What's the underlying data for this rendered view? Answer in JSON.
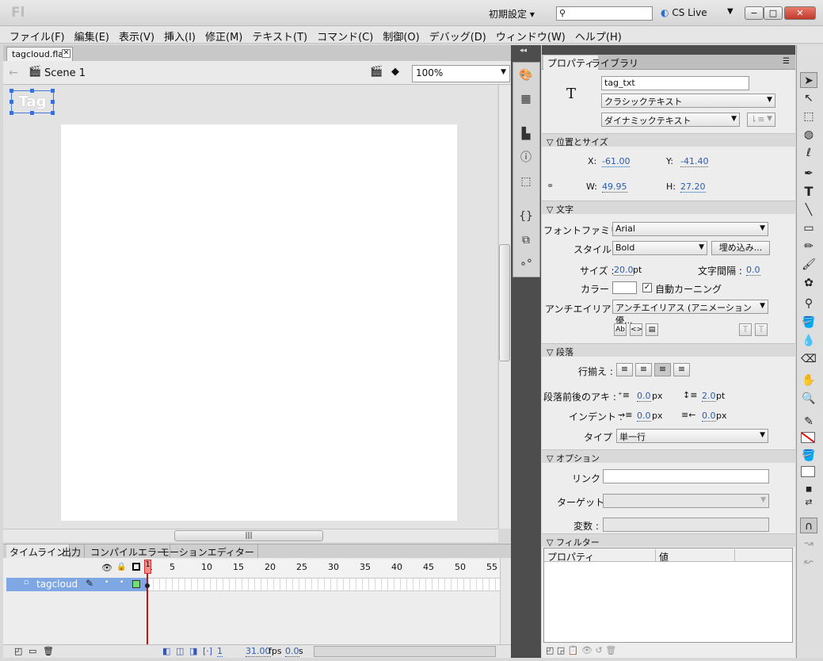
{
  "app": {
    "logo": "Fl",
    "workspace": "初期設定",
    "cs_live": "CS Live"
  },
  "window_buttons": {
    "minimize": "−",
    "maximize": "□",
    "close": "✕"
  },
  "menu": [
    "ファイル(F)",
    "編集(E)",
    "表示(V)",
    "挿入(I)",
    "修正(M)",
    "テキスト(T)",
    "コマンド(C)",
    "制御(O)",
    "デバッグ(D)",
    "ウィンドウ(W)",
    "ヘルプ(H)"
  ],
  "document": {
    "tab": "tagcloud.fla",
    "scene": "Scene 1",
    "zoom": "100%",
    "instance_label": "Tag"
  },
  "timeline": {
    "tabs": [
      "タイムライン",
      "出力",
      "コンパイルエラー",
      "モーションエディター"
    ],
    "layer": "tagcloud",
    "frame_numbers": [
      "1",
      "5",
      "10",
      "15",
      "20",
      "25",
      "30",
      "35",
      "40",
      "45",
      "50",
      "55"
    ],
    "current_frame": "1",
    "fps": "31.00",
    "fps_unit": "fps",
    "time": "0.0",
    "time_unit": "s"
  },
  "properties": {
    "tabs": [
      "プロパティ",
      "ライブラリ"
    ],
    "type_icon": "T",
    "instance_name": "tag_txt",
    "text_engine": "クラシックテキスト",
    "text_type": "ダイナミックテキスト",
    "section_position": "位置とサイズ",
    "x_label": "X:",
    "x": "-61.00",
    "y_label": "Y:",
    "y": "-41.40",
    "w_label": "W:",
    "w": "49.95",
    "h_label": "H:",
    "h": "27.20",
    "section_char": "文字",
    "font_family_label": "フォントファミリー :",
    "font_family": "Arial",
    "style_label": "スタイル :",
    "style": "Bold",
    "embed_button": "埋め込み...",
    "size_label": "サイズ :",
    "size": "20.0",
    "size_unit": "pt",
    "spacing_label": "文字間隔 :",
    "spacing": "0.0",
    "color_label": "カラー :",
    "auto_kern": "自動カーニング",
    "antialias_label": "アンチエイリアス :",
    "antialias": "アンチエイリアス (アニメーション優...",
    "section_paragraph": "段落",
    "align_label": "行揃え :",
    "spacing_pp_label": "段落前後のアキ :",
    "para_before": "0.0",
    "para_before_unit": "px",
    "para_after": "2.0",
    "para_after_unit": "pt",
    "indent_label": "インデント :",
    "indent": "0.0",
    "indent_unit": "px",
    "margin": "0.0",
    "margin_unit": "px",
    "type_label": "タイプ :",
    "line_type": "単一行",
    "section_options": "オプション",
    "link_label": "リンク :",
    "target_label": "ターゲット :",
    "var_label": "変数 :",
    "section_filters": "フィルター",
    "filter_col_prop": "プロパティ",
    "filter_col_value": "値"
  },
  "colors": {
    "accent": "#2a5db0",
    "layer_highlight": "#7ea7e4",
    "playhead": "#cc1111"
  }
}
